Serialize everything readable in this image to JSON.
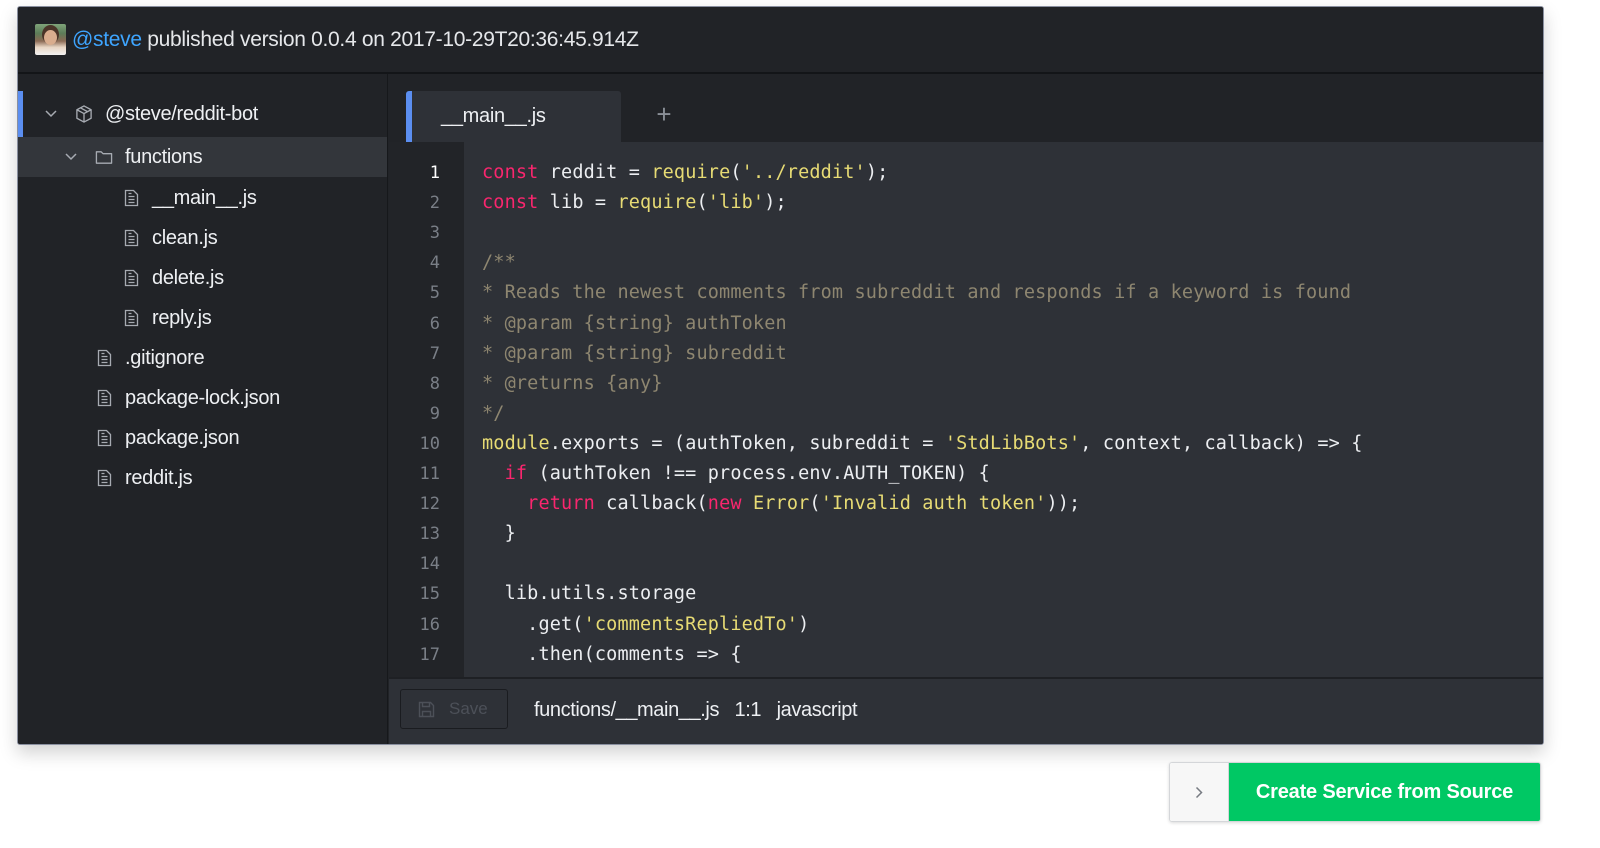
{
  "header": {
    "user": "@steve",
    "message": " published version 0.0.4 on 2017-10-29T20:36:45.914Z",
    "avatar_icon": "user-avatar"
  },
  "sidebar": {
    "root": {
      "label": "@steve/reddit-bot",
      "icon": "package-icon",
      "expanded": true
    },
    "folder": {
      "label": "functions",
      "icon": "folder-icon",
      "expanded": true
    },
    "folder_files": [
      {
        "label": "__main__.js",
        "icon": "file-icon"
      },
      {
        "label": "clean.js",
        "icon": "file-icon"
      },
      {
        "label": "delete.js",
        "icon": "file-icon"
      },
      {
        "label": "reply.js",
        "icon": "file-icon"
      }
    ],
    "root_files": [
      {
        "label": ".gitignore",
        "icon": "file-icon"
      },
      {
        "label": "package-lock.json",
        "icon": "file-icon"
      },
      {
        "label": "package.json",
        "icon": "file-icon"
      },
      {
        "label": "reddit.js",
        "icon": "file-icon"
      }
    ]
  },
  "editor": {
    "tabs": [
      {
        "label": "__main__.js",
        "active": true
      }
    ],
    "add_tab_label": "+",
    "active_line": 1,
    "lines": [
      [
        [
          "kw",
          "const"
        ],
        [
          "tx",
          " reddit = "
        ],
        [
          "fn",
          "require"
        ],
        [
          "tx",
          "("
        ],
        [
          "st",
          "'../reddit'"
        ],
        [
          "tx",
          ");"
        ]
      ],
      [
        [
          "kw",
          "const"
        ],
        [
          "tx",
          " lib = "
        ],
        [
          "fn",
          "require"
        ],
        [
          "tx",
          "("
        ],
        [
          "st",
          "'lib'"
        ],
        [
          "tx",
          ");"
        ]
      ],
      [],
      [
        [
          "cm",
          "/**"
        ]
      ],
      [
        [
          "cm",
          "* Reads the newest comments from subreddit and responds if a keyword is found"
        ]
      ],
      [
        [
          "cm",
          "* @param {string} authToken"
        ]
      ],
      [
        [
          "cm",
          "* @param {string} subreddit"
        ]
      ],
      [
        [
          "cm",
          "* @returns {any}"
        ]
      ],
      [
        [
          "cm",
          "*/"
        ]
      ],
      [
        [
          "fn",
          "module"
        ],
        [
          "tx",
          ".exports = (authToken, subreddit = "
        ],
        [
          "st",
          "'StdLibBots'"
        ],
        [
          "tx",
          ", context, callback) => {"
        ]
      ],
      [
        [
          "tx",
          "  "
        ],
        [
          "kw",
          "if"
        ],
        [
          "tx",
          " (authToken !== process.env.AUTH_TOKEN) {"
        ]
      ],
      [
        [
          "tx",
          "    "
        ],
        [
          "kw",
          "return"
        ],
        [
          "tx",
          " callback("
        ],
        [
          "kw",
          "new"
        ],
        [
          "tx",
          " "
        ],
        [
          "fn",
          "Error"
        ],
        [
          "tx",
          "("
        ],
        [
          "st",
          "'Invalid auth token'"
        ],
        [
          "tx",
          "));"
        ]
      ],
      [
        [
          "tx",
          "  }"
        ]
      ],
      [],
      [
        [
          "tx",
          "  lib.utils.storage"
        ]
      ],
      [
        [
          "tx",
          "    .get("
        ],
        [
          "st",
          "'commentsRepliedTo'"
        ],
        [
          "tx",
          ")"
        ]
      ],
      [
        [
          "tx",
          "    .then(comments => {"
        ]
      ]
    ]
  },
  "statusbar": {
    "save_label": "Save",
    "save_enabled": false,
    "file_path": "functions/__main__.js",
    "cursor": "1:1",
    "language": "javascript"
  },
  "actions": {
    "create_label": "Create Service from Source",
    "expand_icon": "chevron-right-icon"
  },
  "colors": {
    "accent_blue": "#5b8ef0",
    "user_link": "#3ea5ff",
    "keyword": "#f9266e",
    "string_function": "#e7db74",
    "comment": "#8e8670",
    "create_button": "#00c864"
  }
}
